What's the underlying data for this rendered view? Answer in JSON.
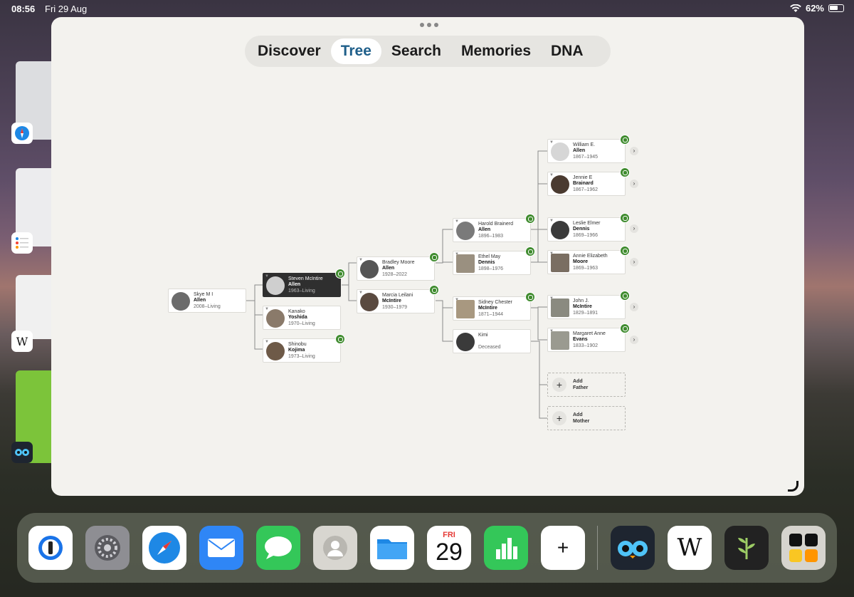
{
  "status": {
    "time": "08:56",
    "date": "Fri 29 Aug",
    "battery": "62%"
  },
  "tabs": [
    {
      "label": "Discover",
      "active": false
    },
    {
      "label": "Tree",
      "active": true
    },
    {
      "label": "Search",
      "active": false
    },
    {
      "label": "Memories",
      "active": false
    },
    {
      "label": "DNA",
      "active": false
    }
  ],
  "people": {
    "skye": {
      "first": "Skye M I",
      "last": "Allen",
      "dates": "2008–Living"
    },
    "steven": {
      "first": "Steven McIntire",
      "last": "Allen",
      "dates": "1963–Living"
    },
    "kanako": {
      "first": "Kanako",
      "last": "Yoshida",
      "dates": "1970–Living"
    },
    "shinobu": {
      "first": "Shinobu",
      "last": "Kojima",
      "dates": "1973–Living"
    },
    "bradley": {
      "first": "Bradley Moore",
      "last": "Allen",
      "dates": "1928–2022"
    },
    "marcia": {
      "first": "Marcia Leilani",
      "last": "McIntire",
      "dates": "1930–1979"
    },
    "harold": {
      "first": "Harold Brainerd",
      "last": "Allen",
      "dates": "1896–1983"
    },
    "ethel": {
      "first": "Ethel May",
      "last": "Dennis",
      "dates": "1898–1976"
    },
    "sidney": {
      "first": "Sidney Chester",
      "last": "McIntire",
      "dates": "1871–1944"
    },
    "kimi": {
      "first": "Kimi",
      "last": "",
      "dates": "Deceased"
    },
    "william": {
      "first": "William E.",
      "last": "Allen",
      "dates": "1867–1945"
    },
    "jennie": {
      "first": "Jennie E",
      "last": "Brainard",
      "dates": "1867–1962"
    },
    "leslie": {
      "first": "Leslie Elmer",
      "last": "Dennis",
      "dates": "1869–1966"
    },
    "annie": {
      "first": "Annie Elizabeth",
      "last": "Moore",
      "dates": "1869–1963"
    },
    "john": {
      "first": "John J.",
      "last": "McIntire",
      "dates": "1829–1891"
    },
    "margaret": {
      "first": "Margaret Anne",
      "last": "Evans",
      "dates": "1833–1902"
    }
  },
  "add_father": {
    "line1": "Add",
    "line2": "Father"
  },
  "add_mother": {
    "line1": "Add",
    "line2": "Mother"
  },
  "calendar": {
    "day": "FRI",
    "date": "29"
  },
  "dock_icons": [
    "1password-icon",
    "settings-icon",
    "safari-icon",
    "mail-icon",
    "messages-icon",
    "contacts-icon",
    "files-icon",
    "calendar-icon",
    "numbers-icon",
    "add-icon",
    "owl-app-icon",
    "wikipedia-icon",
    "ancestry-icon",
    "app-folder-icon"
  ],
  "colors": {
    "hint_green": "#3f8b2e",
    "active_tab": "#1f5f8a",
    "selected_card": "#2f2f2f"
  }
}
